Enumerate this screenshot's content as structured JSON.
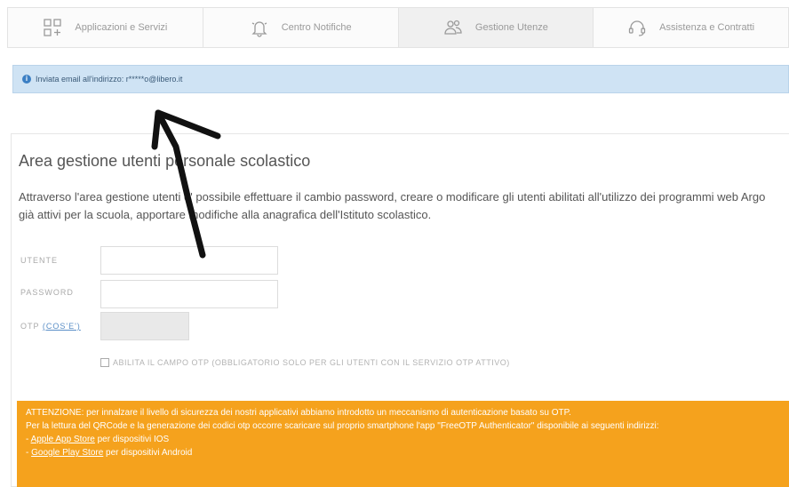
{
  "tabs": [
    {
      "label": "Applicazioni e Servizi",
      "icon": "apps-icon",
      "active": false
    },
    {
      "label": "Centro Notifiche",
      "icon": "bell-icon",
      "active": false
    },
    {
      "label": "Gestione Utenze",
      "icon": "users-icon",
      "active": true
    },
    {
      "label": "Assistenza e Contratti",
      "icon": "headset-icon",
      "active": false
    }
  ],
  "alert": {
    "text": "Inviata email all'indirizzo: r*****o@libero.it",
    "icon": "info-icon"
  },
  "panel": {
    "title": "Area gestione utenti personale scolastico",
    "description": "Attraverso l'area gestione utenti e' possibile effettuare il cambio password, creare o modificare gli utenti abilitati all'utilizzo dei programmi web Argo già attivi per la scuola, apportare modifiche alla anagrafica dell'Istituto scolastico."
  },
  "form": {
    "user_label": "UTENTE",
    "user_value": "",
    "password_label": "PASSWORD",
    "password_value": "",
    "otp_label": "OTP",
    "otp_link": "(COS'E')",
    "otp_value": "",
    "otp_checkbox_label": "ABILITA IL CAMPO OTP (OBBLIGATORIO SOLO PER GLI UTENTI CON IL SERVIZIO OTP ATTIVO)"
  },
  "warning": {
    "line1": "ATTENZIONE: per innalzare il livello di sicurezza dei nostri applicativi abbiamo introdotto un meccanismo di autenticazione basato su OTP.",
    "line2": "Per la lettura del QRCode e la generazione dei codici otp occorre scaricare sul proprio smartphone l'app \"FreeOTP Authenticator\" disponibile ai seguenti indirizzi:",
    "apple_link": "Apple App Store",
    "apple_suffix": " per dispositivi IOS",
    "google_link": "Google Play Store",
    "google_suffix": " per dispositivi Android"
  },
  "colors": {
    "alert_bg": "#cfe3f4",
    "warning_bg": "#f5a21d",
    "link": "#5b8fc7"
  }
}
